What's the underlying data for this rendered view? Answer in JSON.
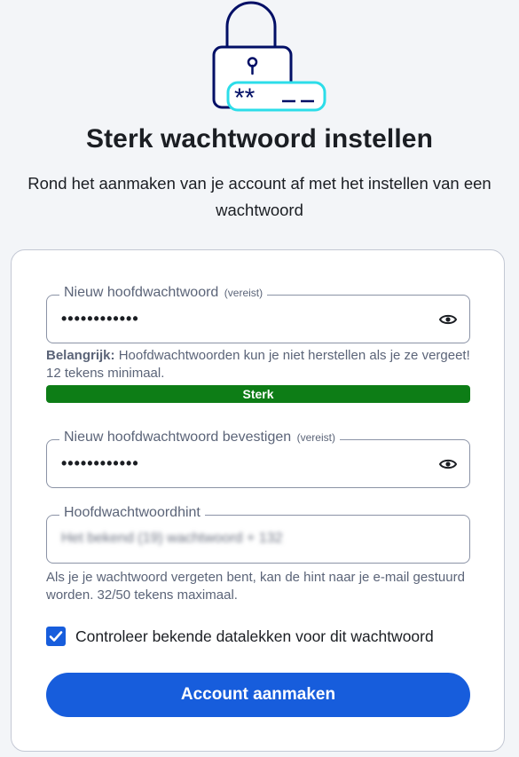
{
  "header": {
    "title": "Sterk wachtwoord instellen",
    "subtitle": "Rond het aanmaken van je account af met het instellen van een wachtwoord"
  },
  "form": {
    "new_password": {
      "label": "Nieuw hoofdwachtwoord",
      "required_tag": "(vereist)",
      "value": "••••••••••••"
    },
    "important_note": {
      "bold": "Belangrijk:",
      "text": " Hoofdwachtwoorden kun je niet herstellen als je ze vergeet! 12 tekens minimaal."
    },
    "strength": {
      "label": "Sterk",
      "color": "#0d7d16",
      "fraction": 1.0
    },
    "confirm_password": {
      "label": "Nieuw hoofdwachtwoord bevestigen",
      "required_tag": "(vereist)",
      "value": "••••••••••••"
    },
    "hint": {
      "label": "Hoofdwachtwoordhint",
      "value": "Het bekend (19) wachtwoord + 132"
    },
    "hint_note": "Als je je wachtwoord vergeten bent, kan de hint naar je e-mail gestuurd worden. 32/50 tekens maximaal.",
    "breach_check": {
      "label": "Controleer bekende datalekken voor dit wachtwoord",
      "checked": true
    },
    "submit_label": "Account aanmaken"
  },
  "colors": {
    "primary": "#175ddc",
    "strength_ok": "#0d7d16",
    "illustration_navy": "#020f66",
    "illustration_teal": "#2cdde9"
  },
  "icons": {
    "toggle_visibility": "eye-icon",
    "checkbox": "check-icon",
    "illustration": "lock-password-illustration"
  }
}
